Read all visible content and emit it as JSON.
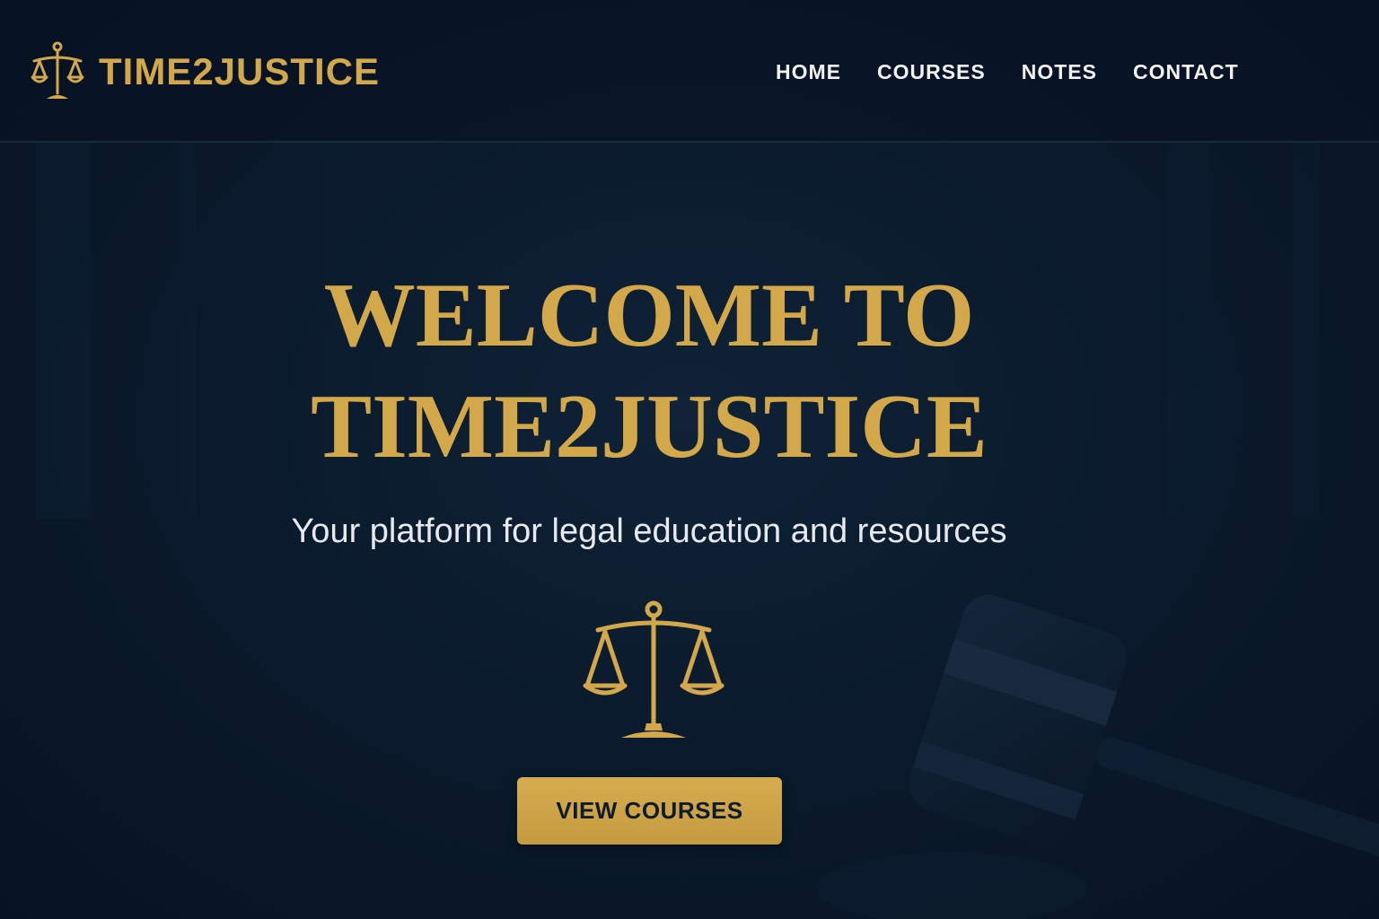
{
  "brand": {
    "name": "TIME2JUSTICE",
    "icon": "scales-of-justice-icon",
    "color": "#d3a84a"
  },
  "nav": {
    "items": [
      {
        "label": "HOME"
      },
      {
        "label": "COURSES"
      },
      {
        "label": "NOTES"
      },
      {
        "label": "CONTACT"
      }
    ]
  },
  "hero": {
    "title_line1": "WELCOME TO",
    "title_line2": "TIME2JUSTICE",
    "subtitle": "Your platform for legal education and resources",
    "icon": "scales-of-justice-icon",
    "cta_label": "VIEW COURSES",
    "background_icon": "gavel-icon"
  },
  "theme": {
    "background": "#0b1a2b",
    "accent": "#d3a84a",
    "text": "#f2f2f2"
  }
}
